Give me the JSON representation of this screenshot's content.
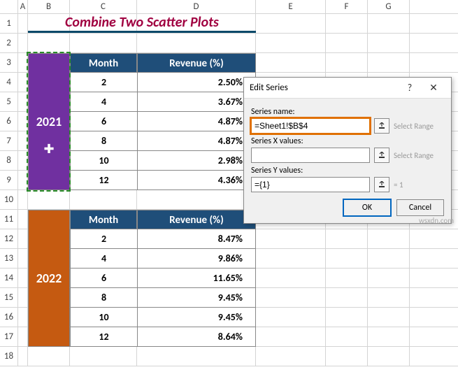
{
  "columns": [
    "A",
    "B",
    "C",
    "D",
    "E",
    "F",
    "G"
  ],
  "title": "Combine Two Scatter Plots",
  "table_headers": {
    "month": "Month",
    "revenue": "Revenue (%)"
  },
  "year1": "2021",
  "year2": "2022",
  "t1": [
    {
      "month": "2",
      "rev": "2.50%"
    },
    {
      "month": "4",
      "rev": "3.67%"
    },
    {
      "month": "6",
      "rev": "4.87%"
    },
    {
      "month": "8",
      "rev": "4.87%"
    },
    {
      "month": "10",
      "rev": "2.98%"
    },
    {
      "month": "12",
      "rev": "4.36%"
    }
  ],
  "t2": [
    {
      "month": "2",
      "rev": "8.47%"
    },
    {
      "month": "4",
      "rev": "9.86%"
    },
    {
      "month": "6",
      "rev": "11.65%"
    },
    {
      "month": "8",
      "rev": "9.45%"
    },
    {
      "month": "10",
      "rev": "9.45%"
    },
    {
      "month": "12",
      "rev": "8.64%"
    }
  ],
  "dialog": {
    "title": "Edit Series",
    "labels": {
      "name": "Series name:",
      "x": "Series X values:",
      "y": "Series Y values:"
    },
    "values": {
      "name": "=Sheet1!$B$4",
      "x": "",
      "y": "={1}"
    },
    "hints": {
      "name": "Select Range",
      "x": "Select Range",
      "y": "= 1"
    },
    "buttons": {
      "ok": "OK",
      "cancel": "Cancel"
    }
  },
  "watermark": "wsxdn.com",
  "cursor_glyph": "✚"
}
